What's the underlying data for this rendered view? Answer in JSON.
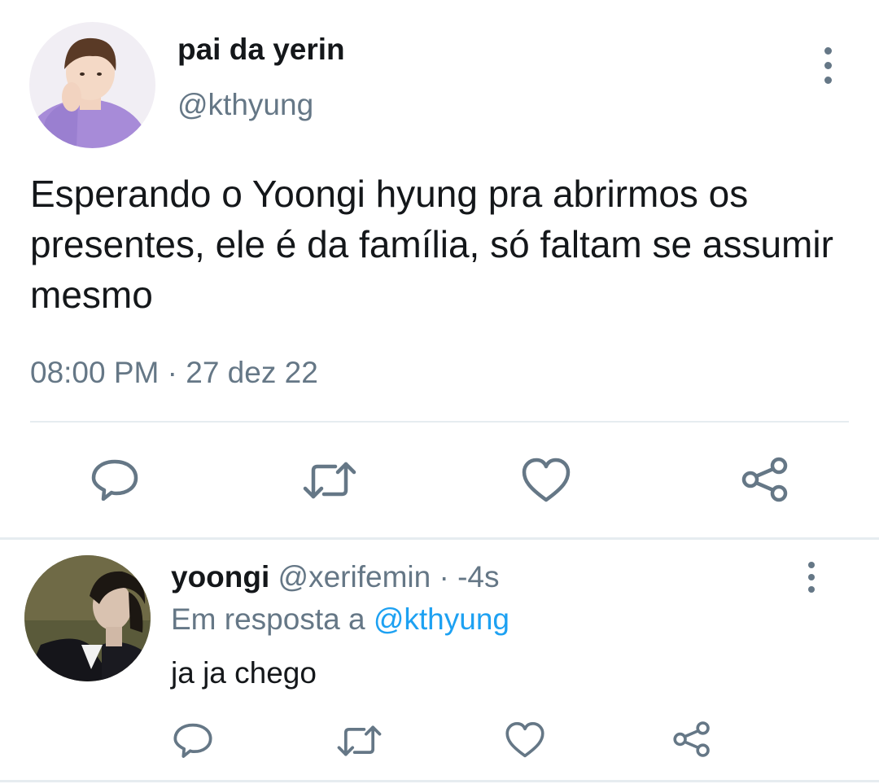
{
  "main_tweet": {
    "author_name": "pai da yerin",
    "author_handle": "@kthyung",
    "text": "Esperando o Yoongi hyung pra abrirmos os presentes, ele é da família, só faltam se assumir mesmo",
    "timestamp": "08:00 PM · 27 dez 22",
    "actions": [
      "reply-icon",
      "retweet-icon",
      "like-icon",
      "share-icon"
    ]
  },
  "reply": {
    "author_name": "yoongi",
    "author_handle": "@xerifemin",
    "time": "· -4s",
    "replying_prefix": "Em resposta a",
    "replying_to": "@kthyung",
    "text": "ja ja chego",
    "actions": [
      "reply-icon",
      "retweet-icon",
      "like-icon",
      "share-icon"
    ]
  },
  "colors": {
    "text": "#14171a",
    "muted": "#657786",
    "link": "#1da1f2",
    "divider": "#e6ecf0"
  }
}
